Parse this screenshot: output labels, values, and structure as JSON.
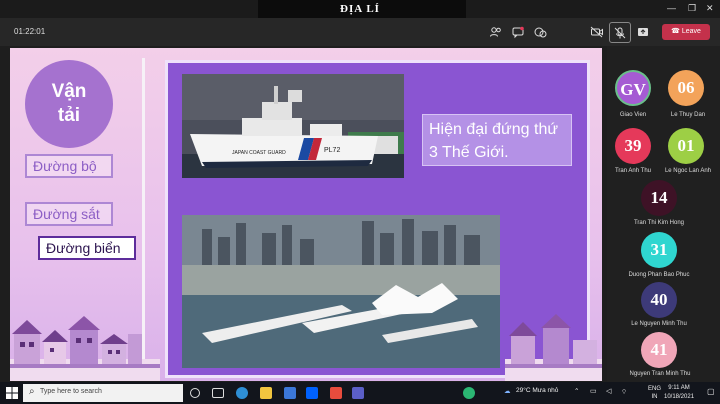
{
  "window": {
    "title": "ĐỊA LÍ",
    "controls": [
      "—",
      "❐",
      "✕"
    ]
  },
  "meeting": {
    "timer": "01:22:01",
    "leave_label": "Leave",
    "toolbar_icons": [
      "people-icon",
      "chat-icon",
      "reactions-icon",
      "camera-icon",
      "microphone-icon",
      "share-icon"
    ]
  },
  "slide": {
    "title": "Vận tải",
    "menu": [
      "Đường bộ",
      "Đường sắt",
      "Đường biển"
    ],
    "callout": "Hiện đại đứng thứ 3 Thế Giới.",
    "photo1_hull_text": "JAPAN COAST GUARD",
    "photo1_number": "PL72",
    "colors": {
      "circle": "#a572cf",
      "panel": "#8a55d2",
      "active_border": "#5d2c9b"
    }
  },
  "participants": [
    {
      "initials": "GV",
      "name": "Giao Vien",
      "color": "#a55bd3"
    },
    {
      "initials": "06",
      "name": "Le Thuy Dan",
      "color": "#f3a35a"
    },
    {
      "initials": "39",
      "name": "Tran Anh Thu",
      "color": "#e5395a"
    },
    {
      "initials": "01",
      "name": "Le Ngoc Lan Anh",
      "color": "#9dcf45"
    },
    {
      "initials": "14",
      "name": "Tran Thi Kim Hong",
      "color": "#3e1226"
    },
    {
      "initials": "31",
      "name": "Duong Phan Bao Phuc",
      "color": "#2fd6d0"
    },
    {
      "initials": "40",
      "name": "Le Nguyen Minh Thu",
      "color": "#3d3a79"
    },
    {
      "initials": "41",
      "name": "Nguyen Tran Minh Thu",
      "color": "#f0a6b8"
    }
  ],
  "taskbar": {
    "search_placeholder": "Type here to search",
    "weather": "29°C  Mưa nhỏ",
    "lang": "ENG",
    "lang2": "IN",
    "time": "9:11 AM",
    "date": "10/18/2021"
  }
}
